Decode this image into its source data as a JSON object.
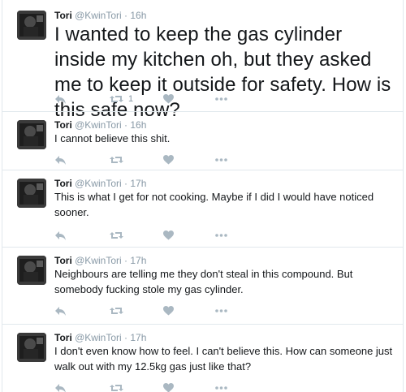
{
  "tweets": [
    {
      "name": "Tori",
      "handle": "@KwinTori",
      "dot": "·",
      "time": "16h",
      "text": "I wanted to keep the gas cylinder inside my kitchen oh, but they asked me to keep it outside for safety. How is this safe now?",
      "retweet_count": "1"
    },
    {
      "name": "Tori",
      "handle": "@KwinTori",
      "dot": "·",
      "time": "16h",
      "text": "I cannot believe this shit.",
      "retweet_count": ""
    },
    {
      "name": "Tori",
      "handle": "@KwinTori",
      "dot": "·",
      "time": "17h",
      "text": "This is what I get for not cooking. Maybe if I did I would have noticed sooner.",
      "retweet_count": ""
    },
    {
      "name": "Tori",
      "handle": "@KwinTori",
      "dot": "·",
      "time": "17h",
      "text": "Neighbours are telling me they don't steal in this compound. But somebody fucking stole my gas cylinder.",
      "retweet_count": ""
    },
    {
      "name": "Tori",
      "handle": "@KwinTori",
      "dot": "·",
      "time": "17h",
      "text": "I don't even know how to feel. I can't believe this. How can someone just walk out with my 12.5kg gas just like that?",
      "retweet_count": ""
    }
  ],
  "icons": {
    "reply": "reply-icon",
    "retweet": "retweet-icon",
    "like": "heart-icon",
    "more": "more-icon"
  },
  "colors": {
    "icon": "#aab8c2",
    "meta": "#8899a6",
    "border": "#e1e8ed"
  }
}
